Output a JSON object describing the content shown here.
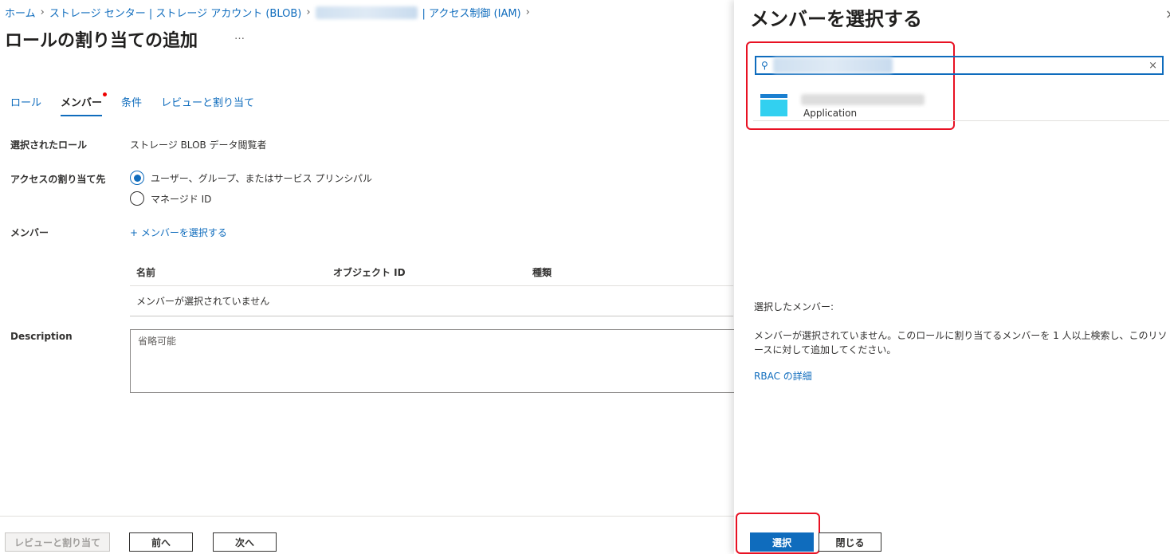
{
  "breadcrumb": [
    "ホーム",
    "ストレージ センター | ストレージ アカウント (BLOB)",
    "| アクセス制御 (IAM)"
  ],
  "page_title": "ロールの割り当ての追加",
  "more": "…",
  "tabs": [
    "ロール",
    "メンバー",
    "条件",
    "レビューと割り当て"
  ],
  "form": {
    "role_label": "選択されたロール",
    "role_value": "ストレージ BLOB データ閲覧者",
    "access_label": "アクセスの割り当て先",
    "access_options": [
      "ユーザー、グループ、またはサービス プリンシパル",
      "マネージド ID"
    ],
    "members_label": "メンバー",
    "select_members": "+ メンバーを選択する",
    "table_headers": [
      "名前",
      "オブジェクト ID",
      "種類"
    ],
    "empty_row": "メンバーが選択されていません",
    "description_label": "Description",
    "description_placeholder": "省略可能"
  },
  "footer": {
    "review": "レビューと割り当て",
    "prev": "前へ",
    "next": "次へ"
  },
  "panel": {
    "title": "メンバーを選択する",
    "close": "×",
    "result_type": "Application",
    "selected_label": "選択したメンバー:",
    "selected_empty": "メンバーが選択されていません。このロールに割り当てるメンバーを 1 人以上検索し、このリソースに対して追加してください。",
    "rbac_link": "RBAC の詳細",
    "select_button": "選択",
    "close_button": "閉じる"
  }
}
